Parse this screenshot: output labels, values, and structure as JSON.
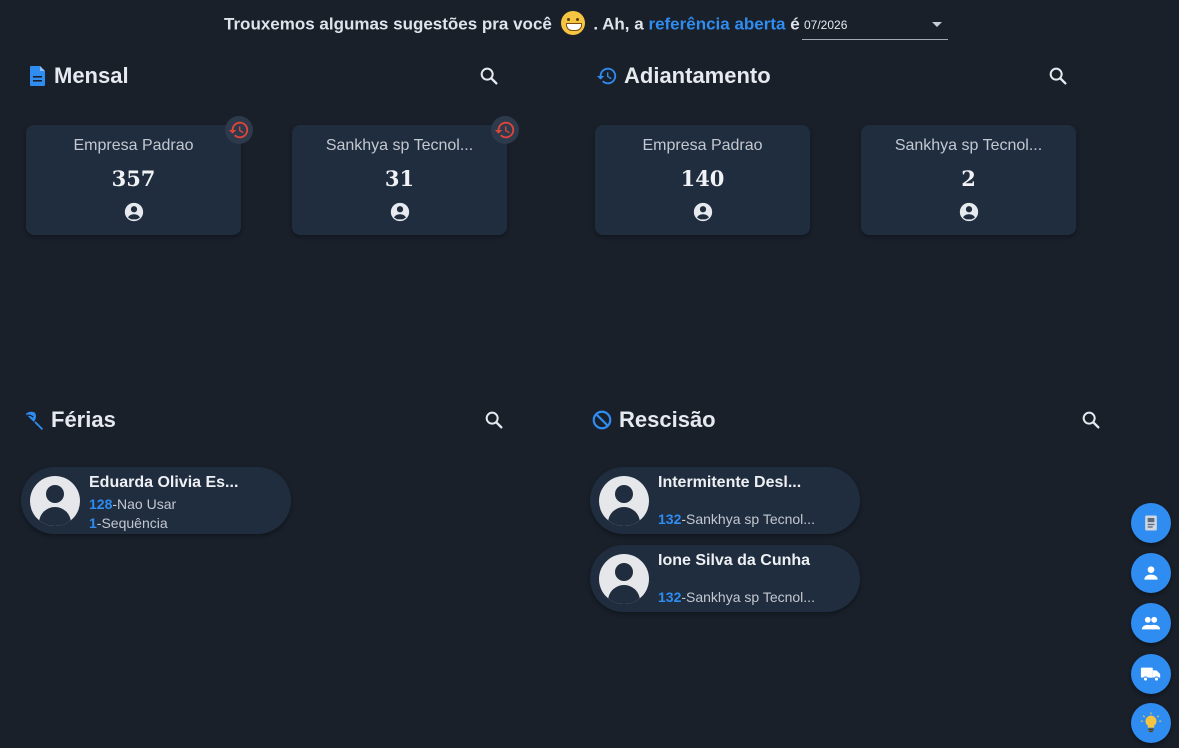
{
  "banner": {
    "text_before": "Trouxemos algumas sugestões pra você",
    "text_mid": ". Ah, a",
    "link": "referência aberta",
    "text_after": "é",
    "reference_value": "07/2026"
  },
  "sections": {
    "mensal": {
      "title": "Mensal",
      "cards": [
        {
          "name": "Empresa Padrao",
          "count": "357"
        },
        {
          "name": "Sankhya sp Tecnol...",
          "count": "31"
        }
      ]
    },
    "adiantamento": {
      "title": "Adiantamento",
      "cards": [
        {
          "name": "Empresa Padrao",
          "count": "140"
        },
        {
          "name": "Sankhya sp Tecnol...",
          "count": "2"
        }
      ]
    },
    "ferias": {
      "title": "Férias",
      "people": [
        {
          "name": "Eduarda Olivia Es...",
          "line1_num": "128",
          "line1_text": "-Nao Usar",
          "line2_num": "1",
          "line2_text": "-Sequência"
        }
      ]
    },
    "rescisao": {
      "title": "Rescisão",
      "people": [
        {
          "name": "Intermitente Desl...",
          "line1_num": "132",
          "line1_text": "-Sankhya sp Tecnol..."
        },
        {
          "name": "Ione Silva da Cunha",
          "line1_num": "132",
          "line1_text": "-Sankhya sp Tecnol..."
        }
      ]
    }
  },
  "fabs": [
    "document-icon",
    "person-icon",
    "group-icon",
    "truck-icon",
    "lightbulb-icon"
  ],
  "colors": {
    "background": "#19202a",
    "card": "#1f2d3f",
    "accent": "#2f8cf0",
    "alert": "#e0443b"
  }
}
